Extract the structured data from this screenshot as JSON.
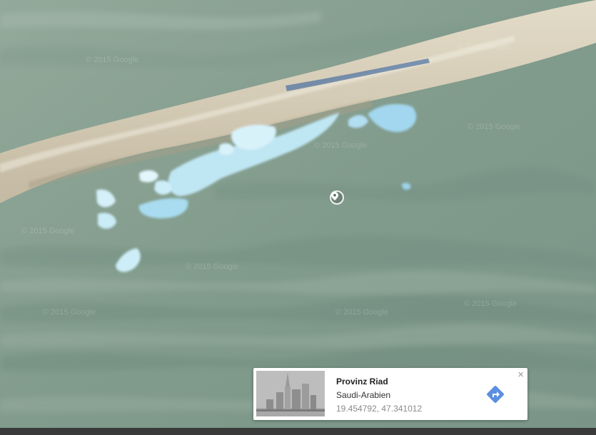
{
  "map": {
    "view": "satellite",
    "watermark_text": "© 2015 Google",
    "marker_icon": "location-pin-icon"
  },
  "info_card": {
    "title": "Provinz Riad",
    "subtitle": "Saudi-Arabien",
    "coordinates": "19.454792, 47.341012",
    "close_label": "×",
    "close_icon": "close-icon",
    "directions_icon": "directions-arrow-icon",
    "directions_color": "#5b8fe0",
    "thumbnail_icon": "city-buildings-thumbnail"
  }
}
